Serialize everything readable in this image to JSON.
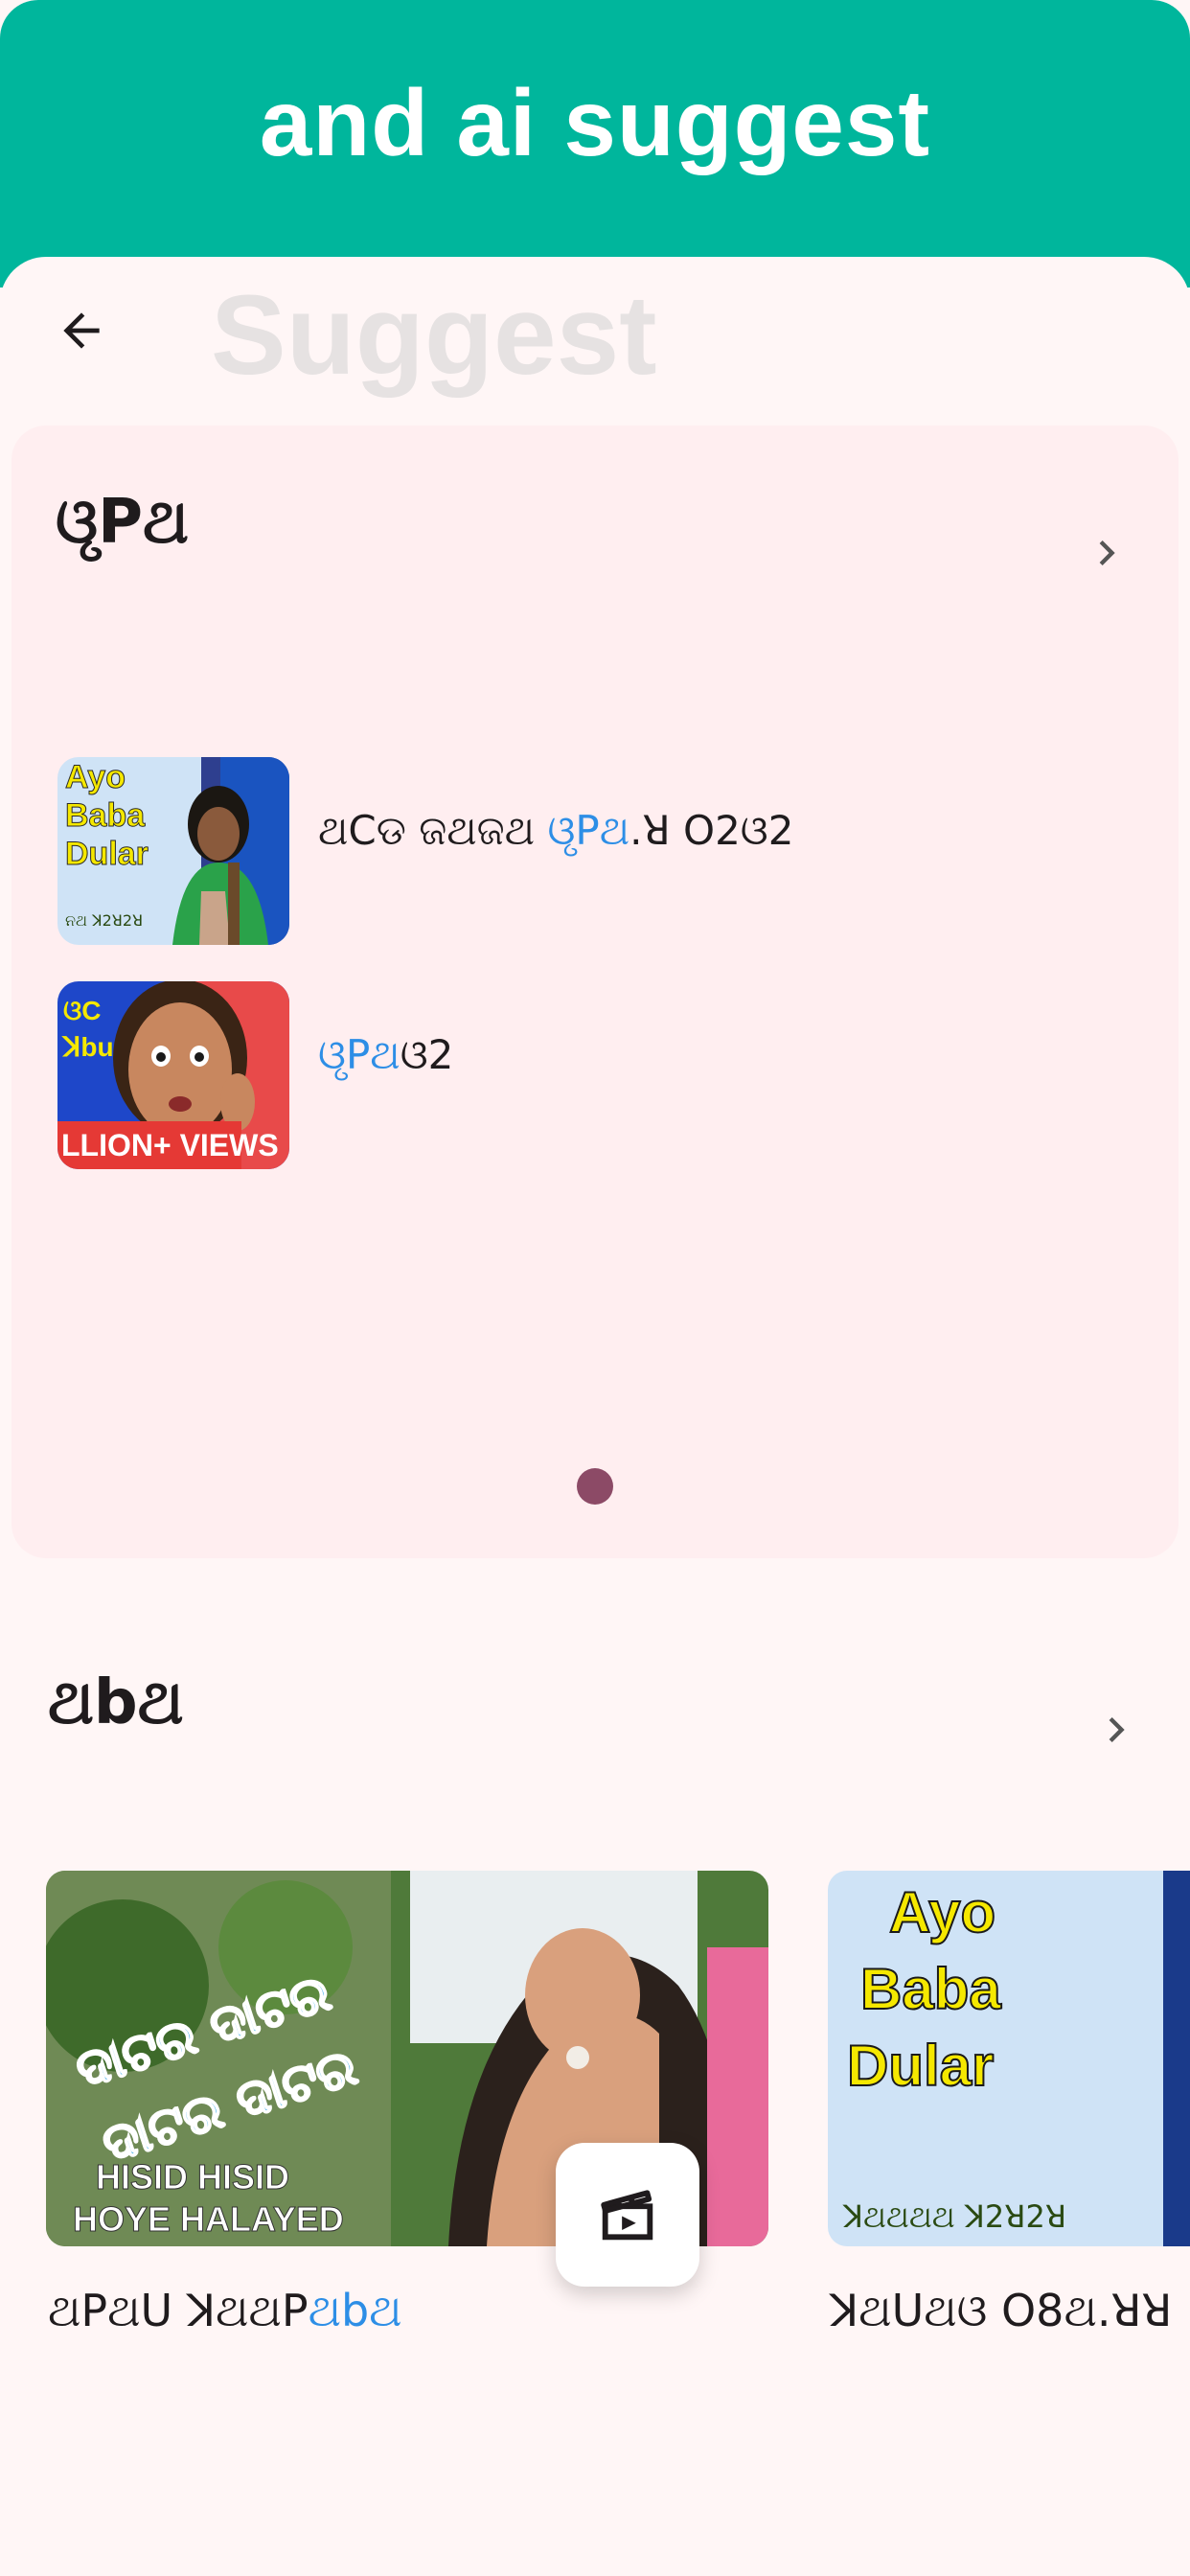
{
  "banner": {
    "title": "and ai suggest"
  },
  "header": {
    "title": "Suggest",
    "back_icon": "arrow-left-icon"
  },
  "section1": {
    "title": "ଓୃPଥ",
    "chevron_icon": "chevron-right-icon",
    "items": [
      {
        "title_pre": "ଥCଡ ଜଥଜଥ ",
        "title_hl": "ଓୃPଥ",
        "title_post": ".ꓤ O2ଓ2",
        "thumb_text": [
          "Ayo",
          "Baba",
          "Dular",
          "ନଥ ꓘ2ꓤ2ꓤ"
        ]
      },
      {
        "title_pre": "",
        "title_hl": "ଓୃPଥ",
        "title_post": "ଓ2",
        "thumb_text": [
          "ଓC",
          "ꓘbu",
          "LLION+ VIEWS"
        ]
      }
    ],
    "pager": {
      "count": 1,
      "active": 0
    }
  },
  "section2": {
    "title": "ଥbଥ",
    "chevron_icon": "chevron-right-icon",
    "videos": [
      {
        "title_pre": "ଥPଥU ꓘଥଥP",
        "title_hl": "ଥbଥ",
        "title_post": "",
        "thumb_text": [
          "ଦାଟର ଦାଟର",
          "ଦାଟର ଦାଟର",
          "HISID HISID",
          "HOYE HALAYED"
        ]
      },
      {
        "title_pre": "ꓘଥUଥଓ O8ଥ.ꓤꓤ",
        "title_hl": "",
        "title_post": "",
        "thumb_text": [
          "Ayo",
          "Baba",
          "Dular",
          "ꓘଥଥଥଥ ꓘ2ꓤ2ꓤ"
        ]
      }
    ]
  },
  "fab": {
    "icon": "clapperboard-icon"
  },
  "colors": {
    "accent": "#00b69c",
    "highlight": "#2d8ee6",
    "card_bg": "#ffeef0",
    "page_bg": "#fff6f6",
    "dot": "#8c4a66"
  }
}
